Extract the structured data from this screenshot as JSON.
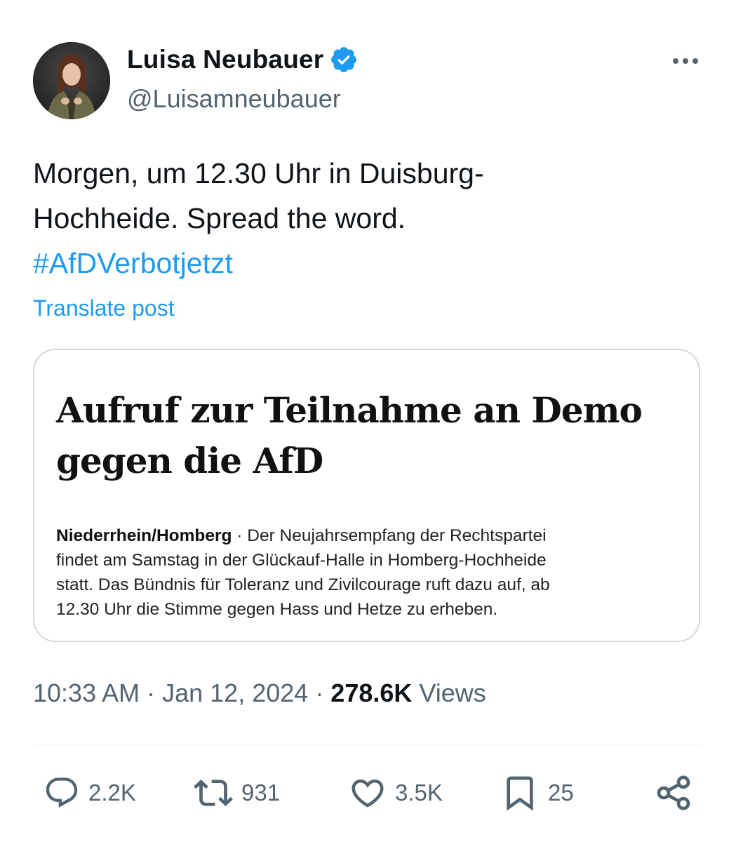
{
  "author": {
    "name": "Luisa Neubauer",
    "handle": "@Luisamneubauer",
    "verified": true
  },
  "tweet": {
    "lines": [
      "Morgen, um 12.30 Uhr in Duisburg-",
      "Hochheide. Spread the word."
    ],
    "hashtag": "#AfDVerbotjetzt",
    "translate_label": "Translate post"
  },
  "card": {
    "headline_lines": [
      "Aufruf zur Teilnahme an Demo",
      "gegen die AfD"
    ],
    "place": "Niederrhein/Homberg",
    "body_first_line_rest": " · Der Neujahrsempfang der Rechtspartei",
    "body_lines": [
      "findet am Samstag in der Glückauf-Halle in Homberg-Hochheide",
      "statt. Das Bündnis für Toleranz und Zivilcourage ruft dazu auf, ab",
      "12.30 Uhr die Stimme gegen Hass und Hetze zu erheben."
    ]
  },
  "meta": {
    "time": "10:33 AM",
    "date": "Jan 12, 2024",
    "separator": " · ",
    "views_count": "278.6K",
    "views_label": " Views"
  },
  "actions": {
    "replies": "2.2K",
    "reposts": "931",
    "likes": "3.5K",
    "bookmarks": "25"
  },
  "colors": {
    "accent": "#1d9bf0",
    "text": "#0f1419",
    "secondary": "#536471",
    "border": "#cfd9de"
  },
  "icons": [
    "verified-badge-icon",
    "more-options-icon",
    "reply-icon",
    "repost-icon",
    "like-icon",
    "bookmark-icon",
    "share-icon"
  ]
}
